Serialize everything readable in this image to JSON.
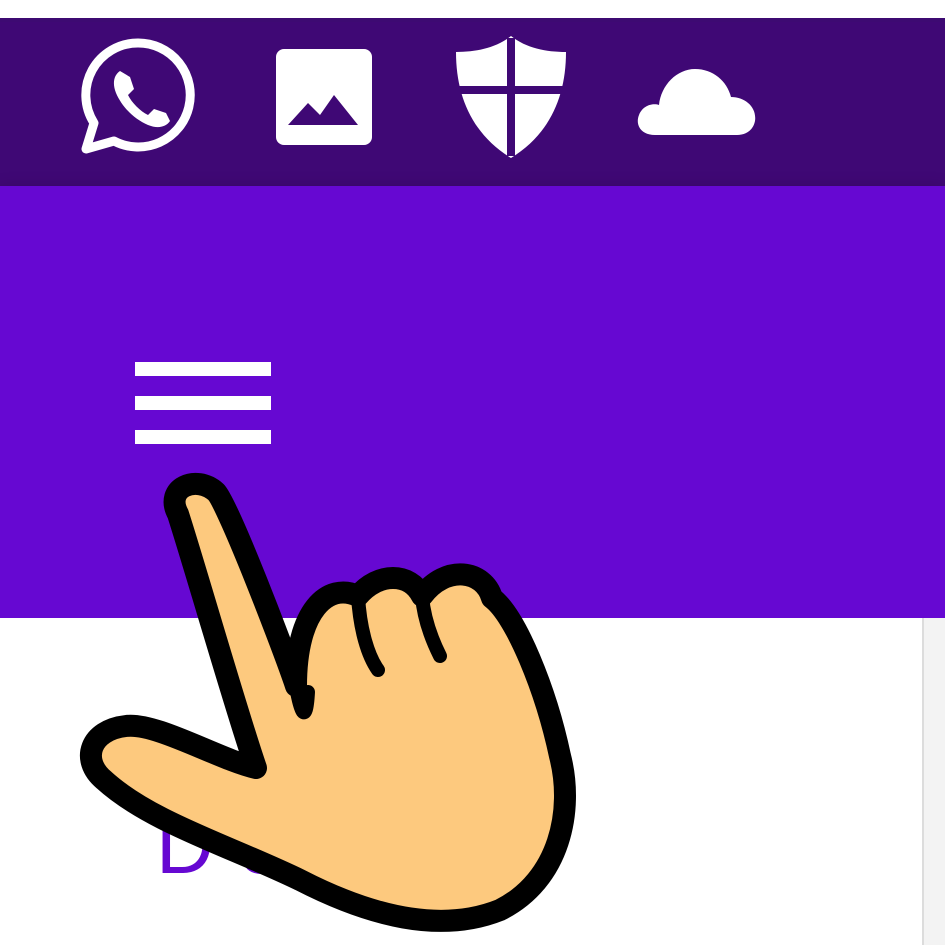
{
  "status_bar": {
    "icons": [
      "whatsapp-icon",
      "gallery-icon",
      "shield-icon",
      "cloud-icon"
    ],
    "background": "#3f0875"
  },
  "app_bar": {
    "background": "#6608d2",
    "menu_icon": "hamburger-menu-icon"
  },
  "content": {
    "article_title": "D     5 -..."
  },
  "overlay": {
    "pointer_icon": "pointing-hand-icon",
    "skin_color": "#fdc97e"
  }
}
